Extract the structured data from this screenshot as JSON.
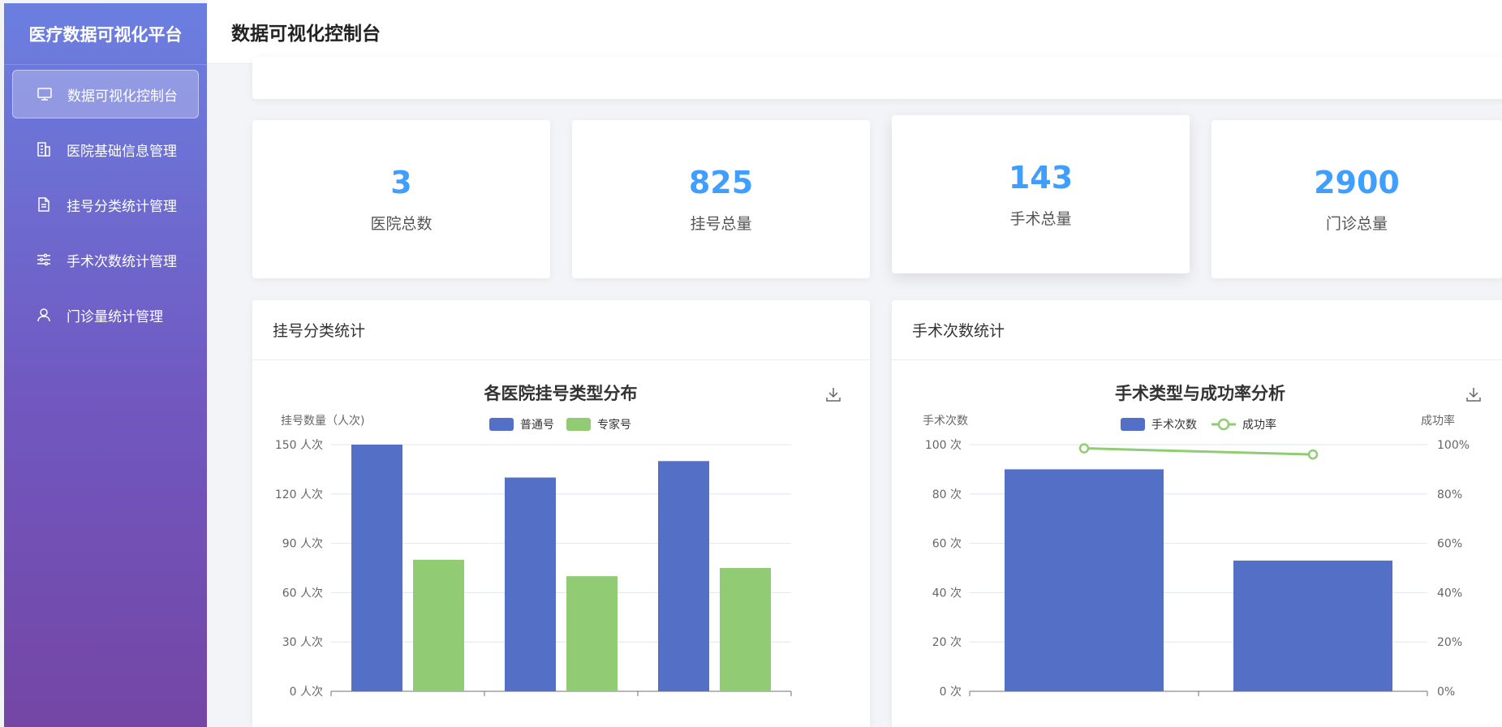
{
  "sidebar": {
    "brand": "医疗数据可视化平台",
    "items": [
      {
        "label": "数据可视化控制台",
        "icon": "monitor-icon",
        "active": true
      },
      {
        "label": "医院基础信息管理",
        "icon": "building-icon",
        "active": false
      },
      {
        "label": "挂号分类统计管理",
        "icon": "document-icon",
        "active": false
      },
      {
        "label": "手术次数统计管理",
        "icon": "sliders-icon",
        "active": false
      },
      {
        "label": "门诊量统计管理",
        "icon": "user-icon",
        "active": false
      }
    ]
  },
  "header": {
    "title": "数据可视化控制台"
  },
  "stats": [
    {
      "value": "3",
      "label": "医院总数"
    },
    {
      "value": "825",
      "label": "挂号总量"
    },
    {
      "value": "143",
      "label": "手术总量"
    },
    {
      "value": "2900",
      "label": "门诊总量"
    }
  ],
  "panels": {
    "registration": {
      "title": "挂号分类统计"
    },
    "surgery": {
      "title": "手术次数统计"
    }
  },
  "colors": {
    "accent": "#409eff",
    "bar_blue": "#5470c6",
    "bar_green": "#91cc75"
  },
  "chart_data": [
    {
      "type": "bar",
      "title": "各医院挂号类型分布",
      "ylabel": "挂号数量（人次)",
      "ylim": [
        0,
        150
      ],
      "yticks": [
        "0 人次",
        "30 人次",
        "60 人次",
        "90 人次",
        "120 人次",
        "150 人次"
      ],
      "categories": [
        "",
        "",
        ""
      ],
      "series": [
        {
          "name": "普通号",
          "values": [
            150,
            130,
            140
          ],
          "color": "#5470c6"
        },
        {
          "name": "专家号",
          "values": [
            80,
            70,
            75
          ],
          "color": "#91cc75"
        }
      ],
      "legend": "top-center",
      "grid": true
    },
    {
      "type": "bar",
      "title": "手术类型与成功率分析",
      "ylabel": "手术次数",
      "y2label": "成功率",
      "ylim": [
        0,
        100
      ],
      "y2lim": [
        0,
        100
      ],
      "yticks": [
        "0 次",
        "20 次",
        "40 次",
        "60 次",
        "80 次",
        "100 次"
      ],
      "y2ticks": [
        "0%",
        "20%",
        "40%",
        "60%",
        "80%",
        "100%"
      ],
      "categories": [
        "",
        ""
      ],
      "series": [
        {
          "name": "手术次数",
          "type": "bar",
          "values": [
            90,
            53
          ],
          "color": "#5470c6"
        },
        {
          "name": "成功率",
          "type": "line",
          "values": [
            98.5,
            96
          ],
          "color": "#91cc75"
        }
      ],
      "legend": "top-center",
      "grid": true
    }
  ]
}
